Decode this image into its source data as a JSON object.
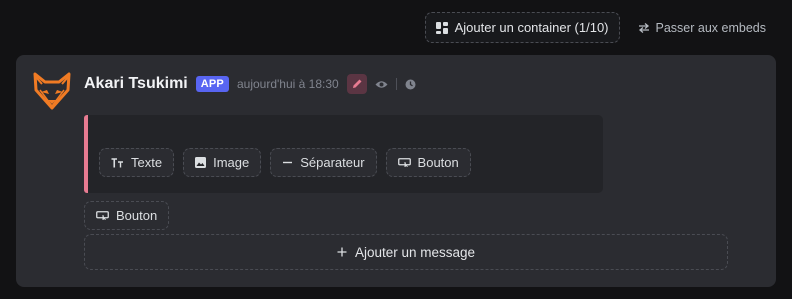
{
  "toolbar": {
    "add_container_label": "Ajouter un container (1/10)",
    "switch_embeds_label": "Passer aux embeds"
  },
  "message": {
    "username": "Akari Tsukimi",
    "badge": "APP",
    "timestamp": "aujourd'hui à 18:30"
  },
  "container": {
    "accent_color": "#e77b91",
    "components": [
      {
        "label": "Texte",
        "icon": "text-icon"
      },
      {
        "label": "Image",
        "icon": "image-icon"
      },
      {
        "label": "Séparateur",
        "icon": "separator-icon"
      },
      {
        "label": "Bouton",
        "icon": "button-icon"
      }
    ]
  },
  "standalone_button": {
    "label": "Bouton",
    "icon": "button-icon"
  },
  "add_message_label": "Ajouter un message",
  "colors": {
    "background": "#121214",
    "card": "#2b2c31",
    "container": "#232428",
    "badge": "#5865f2",
    "avatar_orange": "#f07b24"
  }
}
